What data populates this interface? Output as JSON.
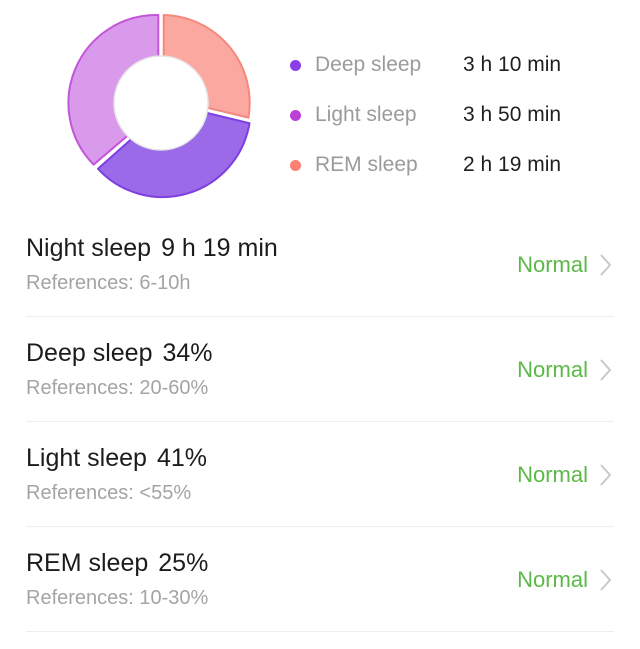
{
  "colors": {
    "deep_sleep": "#9B6AE8",
    "deep_sleep_border": "#7E3FE0",
    "light_sleep": "#DA9AEC",
    "light_sleep_border": "#C355D8",
    "rem_sleep": "#FBA9A0",
    "rem_sleep_border": "#F4887C",
    "status_normal": "#5CB947",
    "inner_ring": "#E6E6E6",
    "divider": "#EEEEEE",
    "background": "#FFFFFF",
    "label_muted": "#9B9B9B",
    "text_primary": "#1C1C1C",
    "chevron": "#C9C9C9"
  },
  "legend": {
    "items": [
      {
        "label": "Deep sleep",
        "value": "3 h 10 min",
        "dot": "legend-dot-deep-sleep",
        "color": "#8B3FE8"
      },
      {
        "label": "Light sleep",
        "value": "3 h 50 min",
        "dot": "legend-dot-light-sleep",
        "color": "#BC3FD8"
      },
      {
        "label": "REM sleep",
        "value": "2 h 19 min",
        "dot": "legend-dot-rem-sleep",
        "color": "#FB8072"
      }
    ]
  },
  "chart_data": {
    "type": "pie",
    "title": "",
    "variant": "donut",
    "categories": [
      "Light sleep",
      "REM sleep",
      "Deep sleep"
    ],
    "values": [
      41,
      25,
      34
    ],
    "value_unit": "%",
    "durations": [
      "3 h 50 min",
      "2 h 19 min",
      "3 h 10 min"
    ],
    "colors": [
      "#DA9AEC",
      "#FBA9A0",
      "#9B6AE8"
    ],
    "border_colors": [
      "#C355D8",
      "#F4887C",
      "#7E3FE0"
    ],
    "start_angle_deg": -90,
    "direction": "clockwise",
    "segment_gap_deg": 3,
    "inner_radius_ratio": 0.6,
    "legend": "right",
    "grid": false
  },
  "rows": [
    {
      "title": "Night sleep",
      "metric": "9 h 19 min",
      "reference": "References: 6-10h",
      "status": "Normal",
      "chevron": "chevron-right-icon"
    },
    {
      "title": "Deep sleep",
      "metric": "34%",
      "reference": "References: 20-60%",
      "status": "Normal",
      "chevron": "chevron-right-icon"
    },
    {
      "title": "Light sleep",
      "metric": "41%",
      "reference": "References: <55%",
      "status": "Normal",
      "chevron": "chevron-right-icon"
    },
    {
      "title": "REM sleep",
      "metric": "25%",
      "reference": "References: 10-30%",
      "status": "Normal",
      "chevron": "chevron-right-icon"
    }
  ]
}
